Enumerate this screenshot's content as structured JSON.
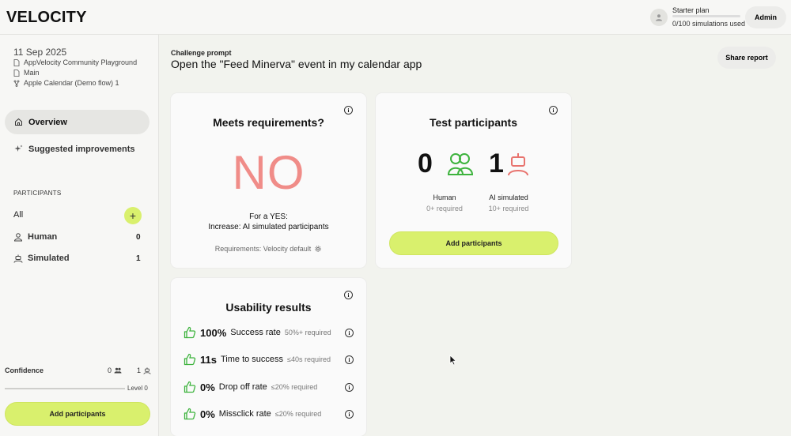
{
  "app": {
    "logo": "VELOCITY"
  },
  "header": {
    "plan_name": "Starter plan",
    "plan_usage": "0/100 simulations used",
    "plan_usage_fraction": 0.0,
    "admin_label": "Admin"
  },
  "sidebar": {
    "date": "11 Sep 2025",
    "breadcrumbs": [
      "AppVelocity Community Playground",
      "Main",
      "Apple Calendar (Demo flow) 1"
    ],
    "nav": [
      {
        "label": "Overview",
        "icon": "home-icon",
        "active": true
      },
      {
        "label": "Suggested improvements",
        "icon": "sparkle-icon",
        "active": false
      }
    ],
    "participants_title": "PARTICIPANTS",
    "all_label": "All",
    "add_symbol": "+",
    "types": [
      {
        "label": "Human",
        "count": "0",
        "icon": "user-icon"
      },
      {
        "label": "Simulated",
        "count": "1",
        "icon": "robot-icon"
      }
    ],
    "confidence_label": "Confidence",
    "confidence_human": "0",
    "confidence_simulated": "1",
    "level_label": "Level 0",
    "add_button": "Add participants"
  },
  "main": {
    "prompt_label": "Challenge prompt",
    "prompt_text": "Open the \"Feed Minerva\" event in my calendar app",
    "share_button": "Share report",
    "requirements_card": {
      "title": "Meets requirements?",
      "result": "NO",
      "yes_line1": "For a YES:",
      "yes_line2": "Increase: AI simulated participants",
      "requirements": "Requirements: Velocity default"
    },
    "participants_card": {
      "title": "Test participants",
      "human_count": "0",
      "human_label": "Human",
      "human_required": "0+ required",
      "ai_count": "1",
      "ai_label": "AI simulated",
      "ai_required": "10+ required",
      "add_button": "Add participants"
    },
    "usability_card": {
      "title": "Usability results",
      "metrics": [
        {
          "value": "100%",
          "name": "Success rate",
          "required": "50%+ required"
        },
        {
          "value": "11s",
          "name": "Time to success",
          "required": "≤40s required"
        },
        {
          "value": "0%",
          "name": "Drop off rate",
          "required": "≤20% required"
        },
        {
          "value": "0%",
          "name": "Missclick rate",
          "required": "≤20% required"
        }
      ]
    }
  },
  "colors": {
    "accent_lime": "#d9f06d",
    "no_red": "#f08c88",
    "human_green": "#3db33d",
    "ai_red": "#e8736e",
    "thumb_green": "#3db33d"
  }
}
